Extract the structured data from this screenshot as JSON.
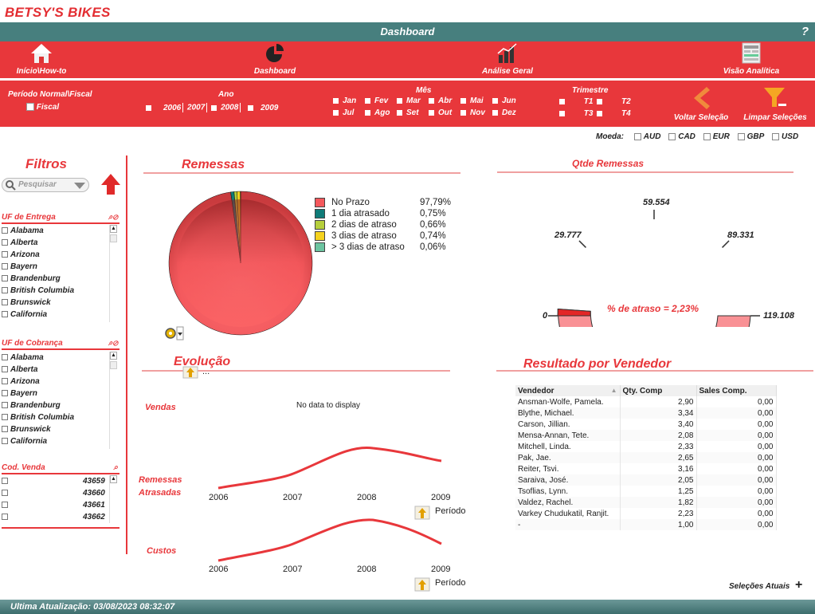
{
  "brand": "BETSY'S BIKES",
  "window_title": "Dashboard",
  "help": "?",
  "nav": [
    {
      "label": "Início\\How-to",
      "icon": "home-icon"
    },
    {
      "label": "Dashboard",
      "icon": "dashboard-icon"
    },
    {
      "label": "Análise Geral",
      "icon": "bar-chart-icon"
    },
    {
      "label": "Visão Analítica",
      "icon": "table-icon"
    }
  ],
  "filters": {
    "periodo_label": "Período Normal\\Fiscal",
    "fiscal_label": "Fiscal",
    "ano_label": "Ano",
    "anos": [
      "2006",
      "2007",
      "2008",
      "2009"
    ],
    "mes_label": "Mês",
    "meses_row1": [
      "Jan",
      "Fev",
      "Mar",
      "Abr",
      "Mai",
      "Jun"
    ],
    "meses_row2": [
      "Jul",
      "Ago",
      "Set",
      "Out",
      "Nov",
      "Dez"
    ],
    "trimestre_label": "Trimestre",
    "trimestres": [
      "T1",
      "T2",
      "T3",
      "T4"
    ],
    "voltar": "Voltar Seleção",
    "limpar": "Limpar Seleções"
  },
  "moeda": {
    "label": "Moeda:",
    "options": [
      "AUD",
      "CAD",
      "EUR",
      "GBP",
      "USD"
    ]
  },
  "left": {
    "title": "Filtros",
    "search_placeholder": "Pesquisar",
    "uf_entrega_label": "UF de Entrega",
    "uf_entrega": [
      "Alabama",
      "Alberta",
      "Arizona",
      "Bayern",
      "Brandenburg",
      "British Columbia",
      "Brunswick",
      "California"
    ],
    "uf_cobranca_label": "UF de Cobrança",
    "uf_cobranca": [
      "Alabama",
      "Alberta",
      "Arizona",
      "Bayern",
      "Brandenburg",
      "British Columbia",
      "Brunswick",
      "California"
    ],
    "cod_venda_label": "Cod. Venda",
    "cod_venda": [
      "43659",
      "43660",
      "43661",
      "43662"
    ]
  },
  "remessas": {
    "title": "Remessas",
    "legend": [
      {
        "label": "No Prazo",
        "pct": "97,79%",
        "color": "#f4585c"
      },
      {
        "label": "1 dia atrasado",
        "pct": "0,75%",
        "color": "#0f7b78"
      },
      {
        "label": "2 dias de atraso",
        "pct": "0,66%",
        "color": "#b6cf3c"
      },
      {
        "label": "3 dias de atraso",
        "pct": "0,74%",
        "color": "#f5d21e"
      },
      {
        "label": "> 3 dias de atraso",
        "pct": "0,06%",
        "color": "#6cc4a0"
      }
    ]
  },
  "chart_data": [
    {
      "type": "pie",
      "title": "Remessas",
      "categories": [
        "No Prazo",
        "1 dia atrasado",
        "2 dias de atraso",
        "3 dias de atraso",
        "> 3 dias de atraso"
      ],
      "values": [
        97.79,
        0.75,
        0.66,
        0.74,
        0.06
      ]
    },
    {
      "type": "gauge",
      "title": "Qtde Remessas",
      "min": 0,
      "max": 119108,
      "ticks": [
        "0",
        "29.777",
        "59.554",
        "89.331",
        "119.108"
      ],
      "value_pct": 2.23,
      "label": "% de atraso = 2,23%"
    }
  ],
  "gauge": {
    "title": "Qtde Remessas",
    "ticks": [
      "0",
      "29.777",
      "59.554",
      "89.331",
      "119.108"
    ],
    "label": "% de atraso = 2,23%"
  },
  "evolucao": {
    "title": "Evolução",
    "vendas_label": "Vendas",
    "no_data": "No data to display",
    "remessas_label1": "Remessas",
    "remessas_label2": "Atrasadas",
    "custos_label": "Custos",
    "years": [
      "2006",
      "2007",
      "2008",
      "2009"
    ],
    "periodo": "Período",
    "ellipsis": "..."
  },
  "vendedor": {
    "title": "Resultado por Vendedor",
    "headers": [
      "Vendedor",
      "Qty. Comp",
      "Sales Comp."
    ],
    "rows": [
      [
        "Ansman-Wolfe, Pamela.",
        "2,90",
        "0,00"
      ],
      [
        "Blythe, Michael.",
        "3,34",
        "0,00"
      ],
      [
        "Carson, Jillian.",
        "3,40",
        "0,00"
      ],
      [
        "Mensa-Annan, Tete.",
        "2,08",
        "0,00"
      ],
      [
        "Mitchell, Linda.",
        "2,33",
        "0,00"
      ],
      [
        "Pak, Jae.",
        "2,65",
        "0,00"
      ],
      [
        "Reiter, Tsvi.",
        "3,16",
        "0,00"
      ],
      [
        "Saraiva, José.",
        "2,05",
        "0,00"
      ],
      [
        "Tsoflias, Lynn.",
        "1,25",
        "0,00"
      ],
      [
        "Valdez, Rachel.",
        "1,82",
        "0,00"
      ],
      [
        "Varkey Chudukatil, Ranjit.",
        "2,23",
        "0,00"
      ],
      [
        "-",
        "1,00",
        "0,00"
      ]
    ]
  },
  "selecoes_atuais": "Seleções Atuais",
  "plus": "+",
  "footer": "Ultima Atualização: 03/08/2023 08:32:07"
}
